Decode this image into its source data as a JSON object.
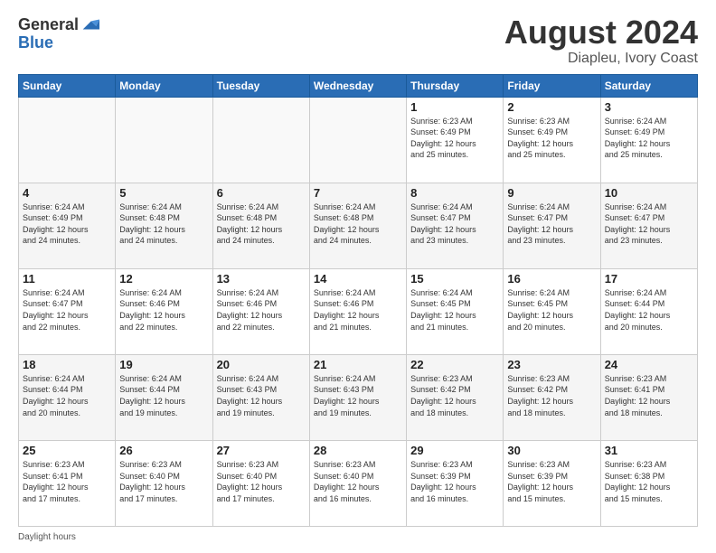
{
  "header": {
    "logo_general": "General",
    "logo_blue": "Blue",
    "title": "August 2024",
    "subtitle": "Diapleu, Ivory Coast"
  },
  "calendar": {
    "days_of_week": [
      "Sunday",
      "Monday",
      "Tuesday",
      "Wednesday",
      "Thursday",
      "Friday",
      "Saturday"
    ],
    "weeks": [
      [
        {
          "day": "",
          "info": ""
        },
        {
          "day": "",
          "info": ""
        },
        {
          "day": "",
          "info": ""
        },
        {
          "day": "",
          "info": ""
        },
        {
          "day": "1",
          "info": "Sunrise: 6:23 AM\nSunset: 6:49 PM\nDaylight: 12 hours\nand 25 minutes."
        },
        {
          "day": "2",
          "info": "Sunrise: 6:23 AM\nSunset: 6:49 PM\nDaylight: 12 hours\nand 25 minutes."
        },
        {
          "day": "3",
          "info": "Sunrise: 6:24 AM\nSunset: 6:49 PM\nDaylight: 12 hours\nand 25 minutes."
        }
      ],
      [
        {
          "day": "4",
          "info": "Sunrise: 6:24 AM\nSunset: 6:49 PM\nDaylight: 12 hours\nand 24 minutes."
        },
        {
          "day": "5",
          "info": "Sunrise: 6:24 AM\nSunset: 6:48 PM\nDaylight: 12 hours\nand 24 minutes."
        },
        {
          "day": "6",
          "info": "Sunrise: 6:24 AM\nSunset: 6:48 PM\nDaylight: 12 hours\nand 24 minutes."
        },
        {
          "day": "7",
          "info": "Sunrise: 6:24 AM\nSunset: 6:48 PM\nDaylight: 12 hours\nand 24 minutes."
        },
        {
          "day": "8",
          "info": "Sunrise: 6:24 AM\nSunset: 6:47 PM\nDaylight: 12 hours\nand 23 minutes."
        },
        {
          "day": "9",
          "info": "Sunrise: 6:24 AM\nSunset: 6:47 PM\nDaylight: 12 hours\nand 23 minutes."
        },
        {
          "day": "10",
          "info": "Sunrise: 6:24 AM\nSunset: 6:47 PM\nDaylight: 12 hours\nand 23 minutes."
        }
      ],
      [
        {
          "day": "11",
          "info": "Sunrise: 6:24 AM\nSunset: 6:47 PM\nDaylight: 12 hours\nand 22 minutes."
        },
        {
          "day": "12",
          "info": "Sunrise: 6:24 AM\nSunset: 6:46 PM\nDaylight: 12 hours\nand 22 minutes."
        },
        {
          "day": "13",
          "info": "Sunrise: 6:24 AM\nSunset: 6:46 PM\nDaylight: 12 hours\nand 22 minutes."
        },
        {
          "day": "14",
          "info": "Sunrise: 6:24 AM\nSunset: 6:46 PM\nDaylight: 12 hours\nand 21 minutes."
        },
        {
          "day": "15",
          "info": "Sunrise: 6:24 AM\nSunset: 6:45 PM\nDaylight: 12 hours\nand 21 minutes."
        },
        {
          "day": "16",
          "info": "Sunrise: 6:24 AM\nSunset: 6:45 PM\nDaylight: 12 hours\nand 20 minutes."
        },
        {
          "day": "17",
          "info": "Sunrise: 6:24 AM\nSunset: 6:44 PM\nDaylight: 12 hours\nand 20 minutes."
        }
      ],
      [
        {
          "day": "18",
          "info": "Sunrise: 6:24 AM\nSunset: 6:44 PM\nDaylight: 12 hours\nand 20 minutes."
        },
        {
          "day": "19",
          "info": "Sunrise: 6:24 AM\nSunset: 6:44 PM\nDaylight: 12 hours\nand 19 minutes."
        },
        {
          "day": "20",
          "info": "Sunrise: 6:24 AM\nSunset: 6:43 PM\nDaylight: 12 hours\nand 19 minutes."
        },
        {
          "day": "21",
          "info": "Sunrise: 6:24 AM\nSunset: 6:43 PM\nDaylight: 12 hours\nand 19 minutes."
        },
        {
          "day": "22",
          "info": "Sunrise: 6:23 AM\nSunset: 6:42 PM\nDaylight: 12 hours\nand 18 minutes."
        },
        {
          "day": "23",
          "info": "Sunrise: 6:23 AM\nSunset: 6:42 PM\nDaylight: 12 hours\nand 18 minutes."
        },
        {
          "day": "24",
          "info": "Sunrise: 6:23 AM\nSunset: 6:41 PM\nDaylight: 12 hours\nand 18 minutes."
        }
      ],
      [
        {
          "day": "25",
          "info": "Sunrise: 6:23 AM\nSunset: 6:41 PM\nDaylight: 12 hours\nand 17 minutes."
        },
        {
          "day": "26",
          "info": "Sunrise: 6:23 AM\nSunset: 6:40 PM\nDaylight: 12 hours\nand 17 minutes."
        },
        {
          "day": "27",
          "info": "Sunrise: 6:23 AM\nSunset: 6:40 PM\nDaylight: 12 hours\nand 17 minutes."
        },
        {
          "day": "28",
          "info": "Sunrise: 6:23 AM\nSunset: 6:40 PM\nDaylight: 12 hours\nand 16 minutes."
        },
        {
          "day": "29",
          "info": "Sunrise: 6:23 AM\nSunset: 6:39 PM\nDaylight: 12 hours\nand 16 minutes."
        },
        {
          "day": "30",
          "info": "Sunrise: 6:23 AM\nSunset: 6:39 PM\nDaylight: 12 hours\nand 15 minutes."
        },
        {
          "day": "31",
          "info": "Sunrise: 6:23 AM\nSunset: 6:38 PM\nDaylight: 12 hours\nand 15 minutes."
        }
      ]
    ]
  },
  "footer": {
    "text": "Daylight hours"
  }
}
